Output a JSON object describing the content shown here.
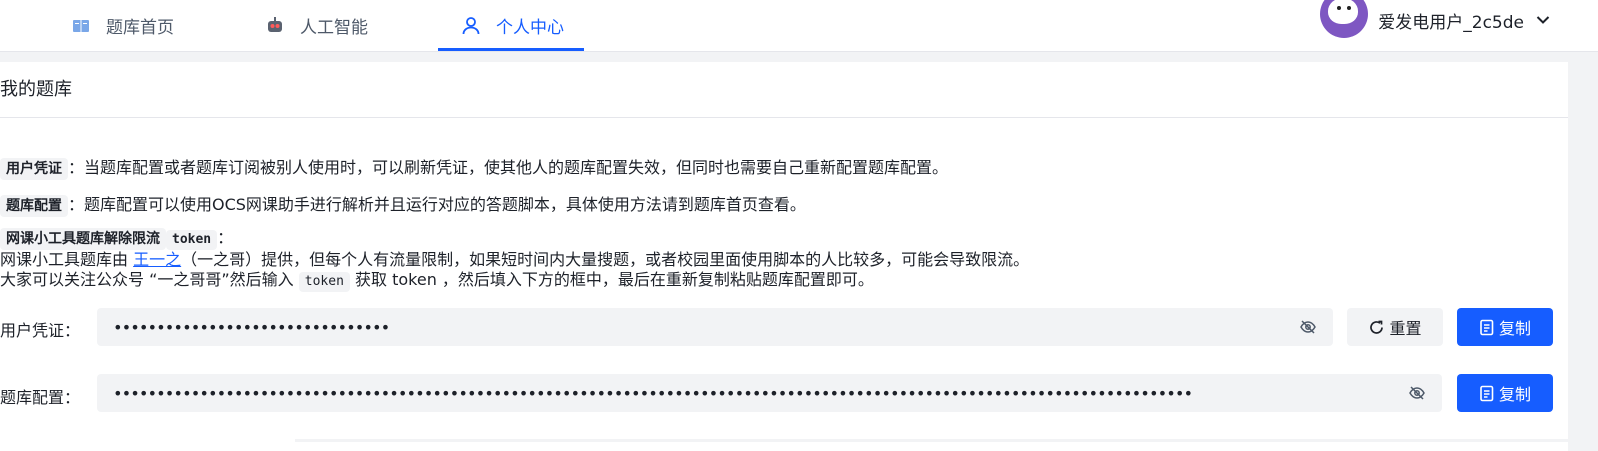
{
  "nav": {
    "tabs": [
      {
        "label": "题库首页",
        "icon": "book-icon"
      },
      {
        "label": "人工智能",
        "icon": "robot-icon"
      },
      {
        "label": "个人中心",
        "icon": "user-icon"
      }
    ],
    "active_tab": "个人中心",
    "user_name": "爱发电用户_2c5de"
  },
  "card": {
    "title": "我的题库",
    "desc1": {
      "tag": "用户凭证",
      "text": "：当题库配置或者题库订阅被别人使用时，可以刷新凭证，使其他人的题库配置失效，但同时也需要自己重新配置题库配置。"
    },
    "desc2": {
      "tag": "题库配置",
      "text": "：题库配置可以使用OCS网课助手进行解析并且运行对应的答题脚本，具体使用方法请到题库首页查看。"
    },
    "desc3": {
      "tag": "网课小工具题库解除限流",
      "tag_code": "token",
      "colon": "：",
      "line1_prefix": "网课小工具题库由",
      "line1_link": "王一之",
      "line1_suffix": "（一之哥）提供，但每个人有流量限制，如果短时间内大量搜题，或者校园里面使用脚本的人比较多，可能会导致限流。",
      "line2_prefix": "大家可以关注公众号 “一之哥哥”然后输入",
      "line2_code": "token",
      "line2_suffix": "获取 token ，然后填入下方的框中，最后在重新复制粘贴题库配置即可。"
    },
    "credential": {
      "label": "用户凭证：",
      "value": "••••••••••••••••••••••••••••••••",
      "reset_label": "重置",
      "copy_label": "复制"
    },
    "config": {
      "label": "题库配置：",
      "value": "•••••••••••••••••••••••••••••••••••••••••••••••••••••••••••••••••••••••••••••••••••••••••••••••••••••••••••••••••••••••••••••",
      "copy_label": "复制"
    }
  },
  "colors": {
    "accent": "#165dff",
    "bg": "#f2f3f5"
  }
}
